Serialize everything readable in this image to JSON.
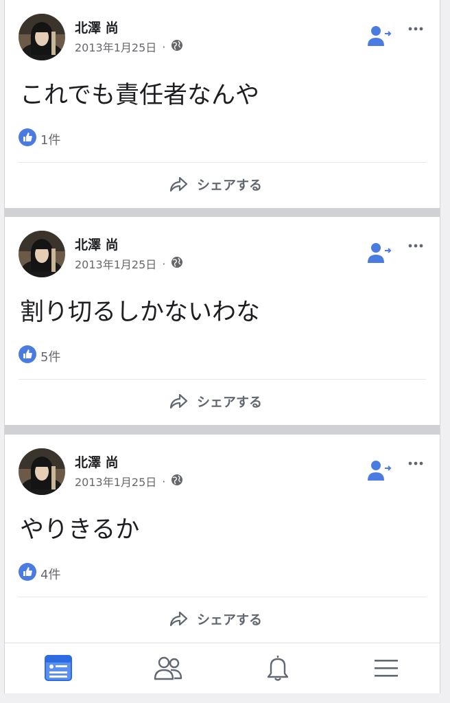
{
  "posts": [
    {
      "author": "北澤 尚",
      "date": "2013年1月25日",
      "separator": "·",
      "text": "これでも責任者なんや",
      "likes": "1件",
      "share_label": "シェアする"
    },
    {
      "author": "北澤 尚",
      "date": "2013年1月25日",
      "separator": "·",
      "text": "割り切るしかないわな",
      "likes": "5件",
      "share_label": "シェアする"
    },
    {
      "author": "北澤 尚",
      "date": "2013年1月25日",
      "separator": "·",
      "text": "やりきるか",
      "likes": "4件",
      "share_label": "シェアする"
    }
  ],
  "icons": {
    "like": "like-thumbs-up-icon",
    "privacy": "globe-icon",
    "follow": "person-follow-icon",
    "more": "more-dots-icon",
    "share": "share-arrow-icon",
    "tabs": [
      "news-feed-icon",
      "friends-icon",
      "notifications-bell-icon",
      "menu-hamburger-icon"
    ]
  },
  "colors": {
    "accent": "#4a7be0",
    "text": "#1c1e21",
    "secondary": "#65676b",
    "separator": "#cfd1d5"
  }
}
